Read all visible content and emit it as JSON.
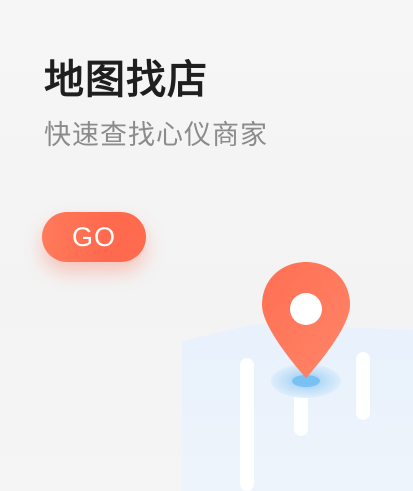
{
  "title": "地图找店",
  "subtitle": "快速查找心仪商家",
  "go_button": {
    "label": "GO",
    "color": "#ff6a4f"
  },
  "illustration": {
    "icon": "map-pin-icon",
    "pin_color": "#ff6a4f",
    "map_color": "#e7f0fb"
  }
}
